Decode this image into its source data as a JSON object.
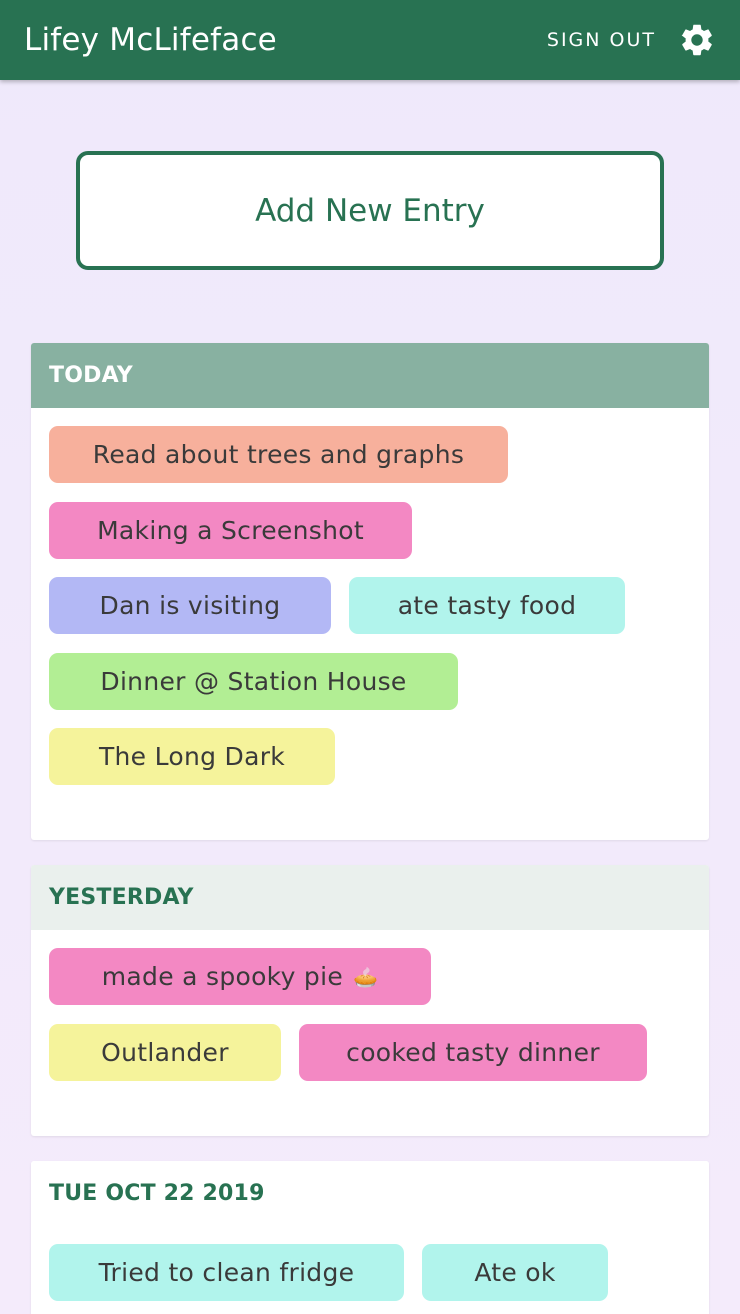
{
  "app": {
    "title": "Lifey McLifeface",
    "sign_out": "SIGN OUT",
    "settings_icon": "gear-icon"
  },
  "add_entry": {
    "label": "Add New Entry"
  },
  "colors": {
    "primary": "#287252",
    "today_header": "#88b1a1",
    "yesterday_header": "#eaf0ed",
    "chip_salmon": "#f7b09c",
    "chip_pink": "#f388c3",
    "chip_blue": "#b3b8f5",
    "chip_cyan": "#b1f4ec",
    "chip_green": "#b2ee94",
    "chip_yellow": "#f5f39b"
  },
  "days": [
    {
      "title": "TODAY",
      "entries": [
        {
          "label": "Read about trees and graphs",
          "color": "salmon"
        },
        {
          "label": "Making a Screenshot",
          "color": "pink"
        },
        {
          "label": "Dan is visiting",
          "color": "blue"
        },
        {
          "label": "ate tasty food",
          "color": "cyan"
        },
        {
          "label": "Dinner @ Station House",
          "color": "green"
        },
        {
          "label": "The Long Dark",
          "color": "yellow"
        }
      ]
    },
    {
      "title": "YESTERDAY",
      "entries": [
        {
          "label": "made a spooky pie",
          "emoji": "🥧",
          "color": "pink"
        },
        {
          "label": "Outlander",
          "color": "yellow"
        },
        {
          "label": "cooked tasty dinner",
          "color": "pink"
        }
      ]
    },
    {
      "title": "TUE OCT 22 2019",
      "entries": [
        {
          "label": "Tried to clean fridge",
          "color": "cyan"
        },
        {
          "label": "Ate ok",
          "color": "cyan"
        }
      ]
    }
  ]
}
